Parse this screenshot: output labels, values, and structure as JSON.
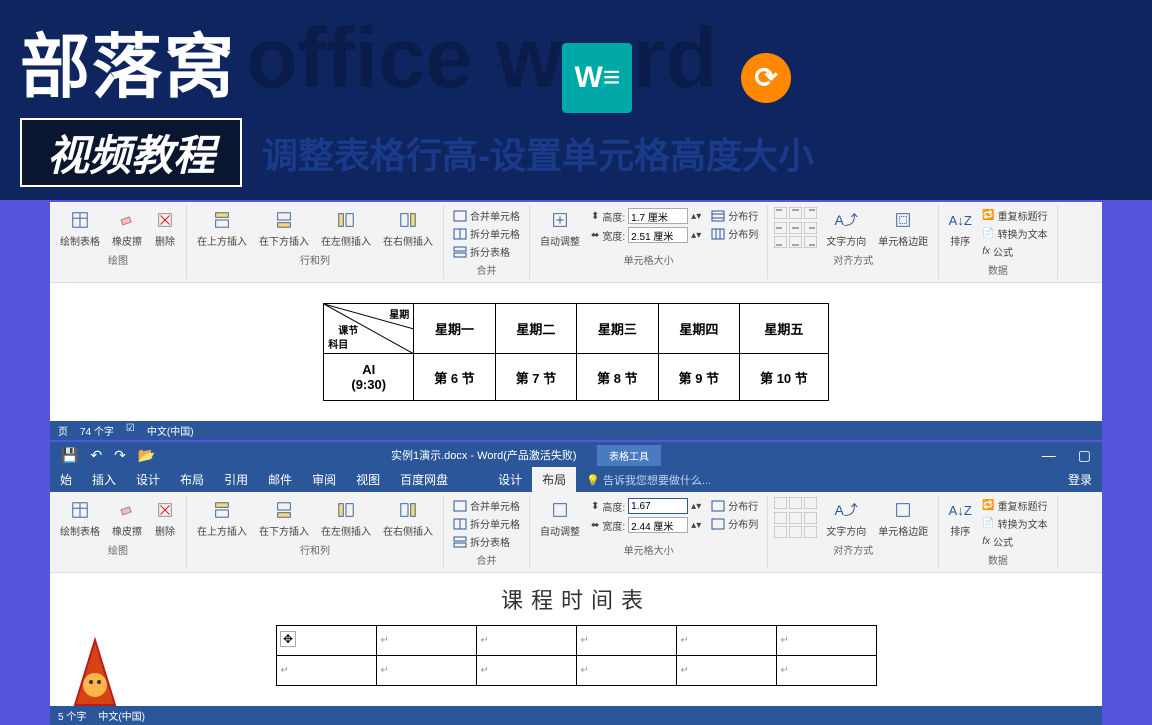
{
  "banner": {
    "logo": "部落窝",
    "brand": "office w",
    "brand2": "rd",
    "video_badge": "视频教程",
    "subtitle": "调整表格行高-设置单元格高度大小"
  },
  "ribbon": {
    "draw": {
      "draw_table": "绘制表格",
      "eraser": "橡皮擦",
      "delete": "删除",
      "group": "绘图"
    },
    "rows": {
      "insert_above": "在上方插入",
      "insert_below": "在下方插入",
      "insert_left": "在左侧插入",
      "insert_right": "在右侧插入",
      "group": "行和列"
    },
    "merge": {
      "merge_cells": "合并单元格",
      "split_cells": "拆分单元格",
      "split_table": "拆分表格",
      "group": "合并"
    },
    "size": {
      "autofit": "自动调整",
      "height_label": "高度:",
      "width_label": "宽度:",
      "dist_rows": "分布行",
      "dist_cols": "分布列",
      "group": "单元格大小"
    },
    "align": {
      "text_dir": "文字方向",
      "cell_margin": "单元格边距",
      "group": "对齐方式"
    },
    "data": {
      "sort": "排序",
      "repeat_header": "重复标题行",
      "convert_text": "转换为文本",
      "formula": "公式",
      "group": "数据"
    }
  },
  "window1": {
    "height_value": "1.7 厘米",
    "width_value": "2.51 厘米",
    "table": {
      "diag": {
        "top": "星期",
        "mid": "课节",
        "bot": "科目"
      },
      "headers": [
        "星期一",
        "星期二",
        "星期三",
        "星期四",
        "星期五"
      ],
      "row2_first": "AI (9:30)",
      "row2": [
        "第 6 节",
        "第 7 节",
        "第 8 节",
        "第 9 节",
        "第 10 节"
      ]
    },
    "status": {
      "page": "页",
      "words": "74 个字",
      "lang_icon": "",
      "lang": "中文(中国)"
    }
  },
  "window2": {
    "title": "实例1演示.docx - Word(产品激活失败)",
    "context_title": "表格工具",
    "tabs": {
      "start": "始",
      "insert": "插入",
      "design": "设计",
      "layout": "布局",
      "reference": "引用",
      "mail": "邮件",
      "review": "审阅",
      "view": "视图",
      "baidu": "百度网盘",
      "ctx_design": "设计",
      "ctx_layout": "布局"
    },
    "tell_me": "告诉我您想要做什么...",
    "login": "登录",
    "height_value": "1.67",
    "width_value": "2.44 厘米",
    "doc_title": "课程时间表",
    "status": {
      "words": "5 个字",
      "lang": "中文(中国)"
    }
  }
}
